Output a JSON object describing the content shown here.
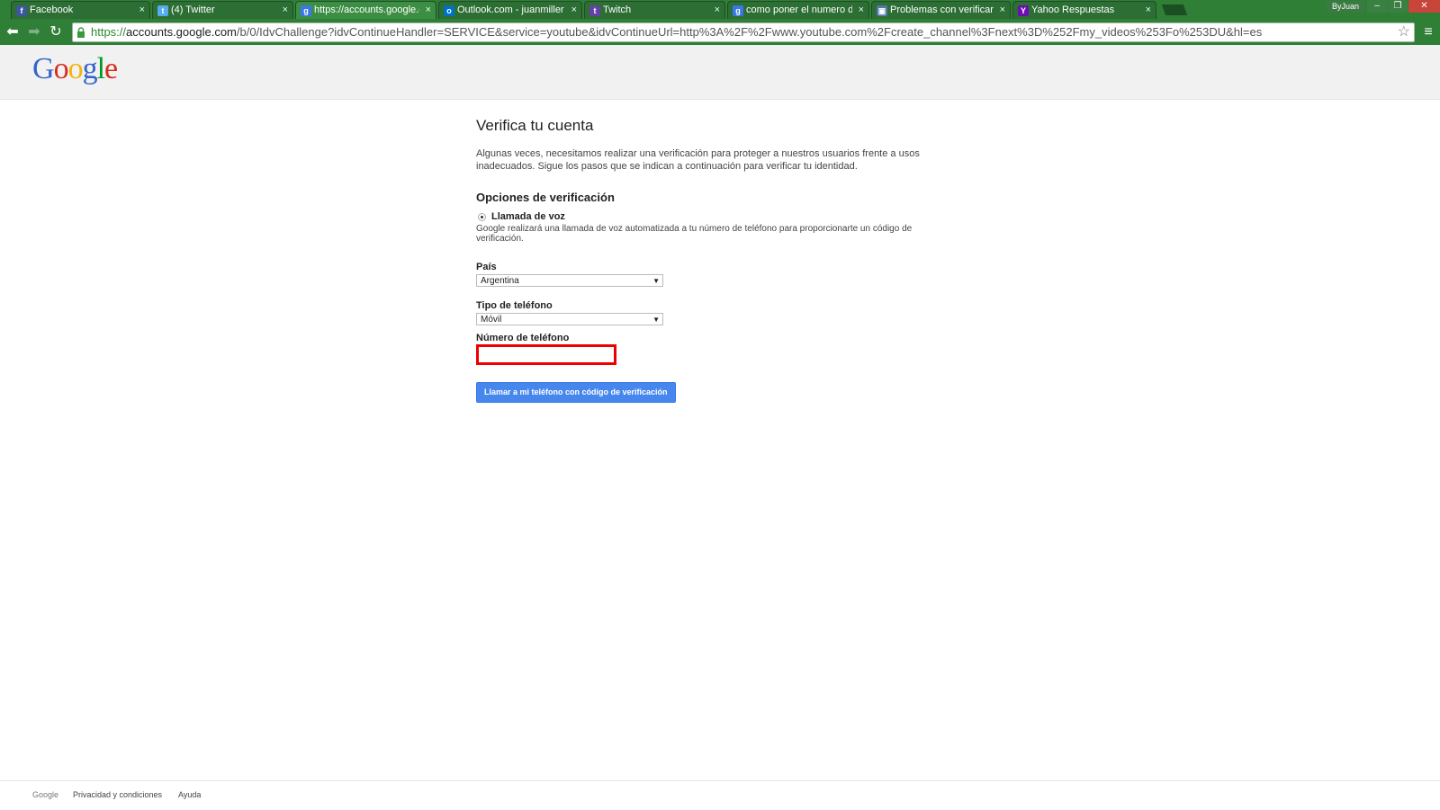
{
  "browser": {
    "tabs": [
      {
        "label": "Facebook",
        "icon": "facebook-icon"
      },
      {
        "label": "(4) Twitter",
        "icon": "twitter-icon"
      },
      {
        "label": "https://accounts.google.c",
        "icon": "google-icon"
      },
      {
        "label": "Outlook.com - juanmiller",
        "icon": "outlook-icon"
      },
      {
        "label": "Twitch",
        "icon": "twitch-icon"
      },
      {
        "label": "como poner el numero de",
        "icon": "google-icon"
      },
      {
        "label": "Problemas con verificar cu",
        "icon": "page-icon"
      },
      {
        "label": "Yahoo Respuestas",
        "icon": "yahoo-icon"
      }
    ],
    "tab_close_glyph": "×",
    "user_label": "ByJuan",
    "url_scheme": "https://",
    "url_host": "accounts.google.com",
    "url_path": "/b/0/IdvChallenge?idvContinueHandler=SERVICE&service=youtube&idvContinueUrl=http%3A%2F%2Fwww.youtube.com%2Fcreate_channel%3Fnext%3D%252Fmy_videos%253Fo%253DU&hl=es"
  },
  "header": {
    "logo": "Google"
  },
  "main": {
    "title": "Verifica tu cuenta",
    "intro": "Algunas veces, necesitamos realizar una verificación para proteger a nuestros usuarios frente a usos inadecuados. Sigue los pasos que se indican a continuación para verificar tu identidad.",
    "options_heading": "Opciones de verificación",
    "option_label": "Llamada de voz",
    "option_desc": "Google realizará una llamada de voz automatizada a tu número de teléfono para proporcionarte un código de verificación.",
    "country_label": "País",
    "country_value": "Argentina",
    "phone_type_label": "Tipo de teléfono",
    "phone_type_value": "Móvil",
    "phone_number_label": "Número de teléfono",
    "phone_number_value": "",
    "call_button": "Llamar a mi teléfono con código de verificación"
  },
  "footer": {
    "google": "Google",
    "privacy": "Privacidad y condiciones",
    "help": "Ayuda"
  },
  "colors": {
    "chrome_frame": "#2f7f37",
    "button_blue": "#4787ed",
    "highlight_red": "#e00000"
  }
}
